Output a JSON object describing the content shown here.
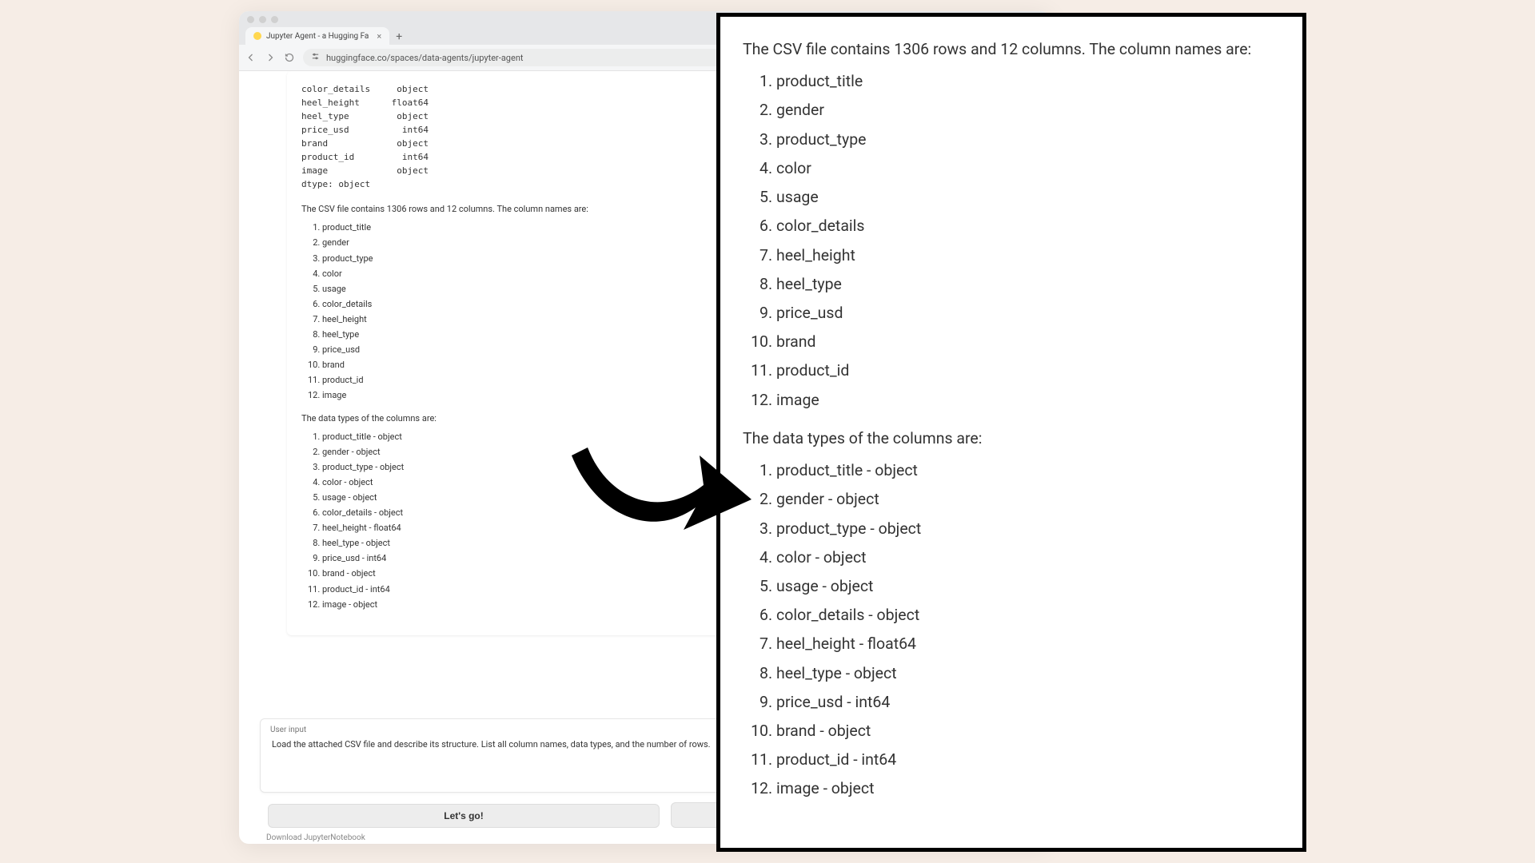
{
  "browser": {
    "tab": {
      "title": "Jupyter Agent - a Hugging Fa",
      "close": "×",
      "new": "+"
    },
    "url": "huggingface.co/spaces/data-agents/jupyter-agent",
    "dtypes_block": "color_details     object\nheel_height      float64\nheel_type         object\nprice_usd          int64\nbrand             object\nproduct_id         int64\nimage             object\ndtype: object",
    "summary": "The CSV file contains 1306 rows and 12 columns. The column names are:",
    "columns": [
      "product_title",
      "gender",
      "product_type",
      "color",
      "usage",
      "color_details",
      "heel_height",
      "heel_type",
      "price_usd",
      "brand",
      "product_id",
      "image"
    ],
    "dtypes_heading": "The data types of the columns are:",
    "dtypes_list": [
      "product_title - object",
      "gender - object",
      "product_type - object",
      "color - object",
      "usage - object",
      "color_details - object",
      "heel_height - float64",
      "heel_type - object",
      "price_usd - int64",
      "brand - object",
      "product_id - int64",
      "image - object"
    ],
    "input_label": "User input",
    "input_value": "Load the attached CSV file and describe its structure. List all column names, data types, and the number of rows.",
    "go_label": "Let's go!",
    "dl_label": "Download JupyterNotebook"
  },
  "zoom": {
    "summary": "The CSV file contains 1306 rows and 12 columns. The column names are:",
    "columns": [
      "product_title",
      "gender",
      "product_type",
      "color",
      "usage",
      "color_details",
      "heel_height",
      "heel_type",
      "price_usd",
      "brand",
      "product_id",
      "image"
    ],
    "dtypes_heading": "The data types of the columns are:",
    "dtypes_list": [
      "product_title - object",
      "gender - object",
      "product_type - object",
      "color - object",
      "usage - object",
      "color_details - object",
      "heel_height - float64",
      "heel_type - object",
      "price_usd - int64",
      "brand - object",
      "product_id - int64",
      "image - object"
    ]
  }
}
